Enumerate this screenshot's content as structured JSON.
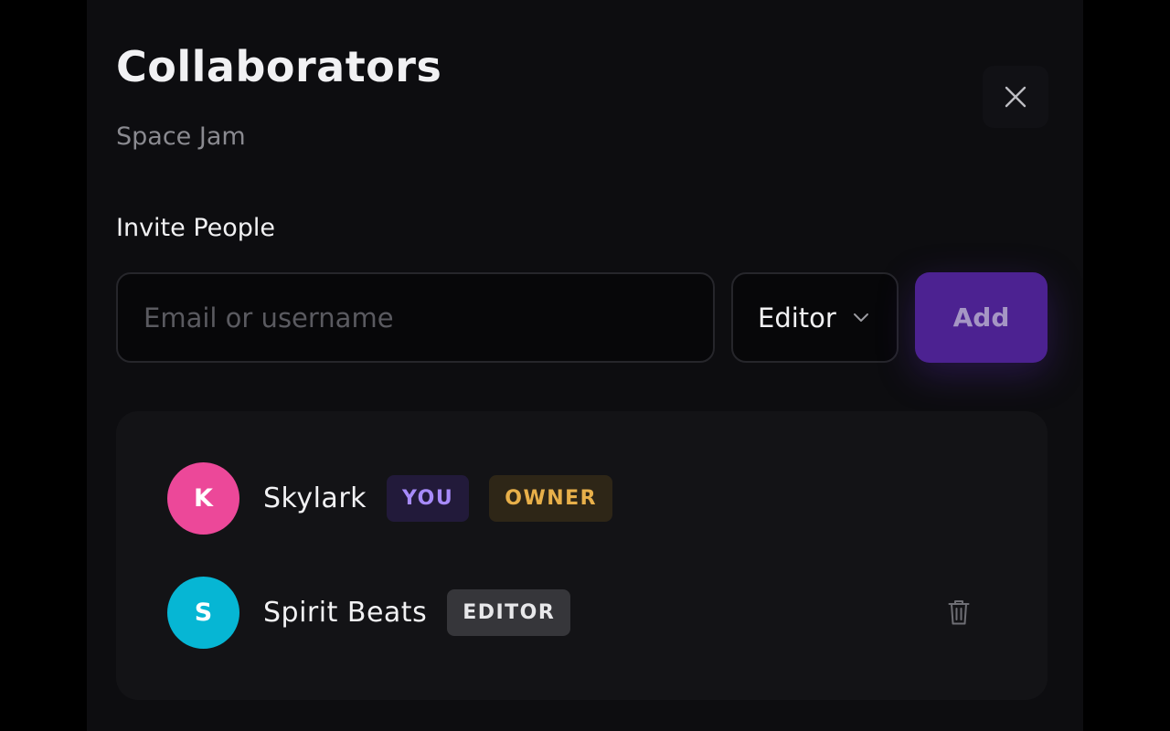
{
  "modal": {
    "title": "Collaborators",
    "subtitle": "Space Jam",
    "close_icon": "close-icon"
  },
  "invite": {
    "label": "Invite People",
    "input_value": "",
    "input_placeholder": "Email or username",
    "role": "Editor",
    "role_icon": "chevron-down-icon",
    "add_label": "Add"
  },
  "collaborators": [
    {
      "initial": "K",
      "name": "Skylark",
      "avatar_color": "#ec4899",
      "badges": [
        "YOU",
        "OWNER"
      ]
    },
    {
      "initial": "S",
      "name": "Spirit Beats",
      "avatar_color": "#06b6d4",
      "badges": [
        "EDITOR"
      ],
      "action_icon": "trash-icon"
    }
  ],
  "colors": {
    "accent": "#4c2291",
    "you_badge": "#a78bfa",
    "owner_badge": "#e8b04a"
  }
}
